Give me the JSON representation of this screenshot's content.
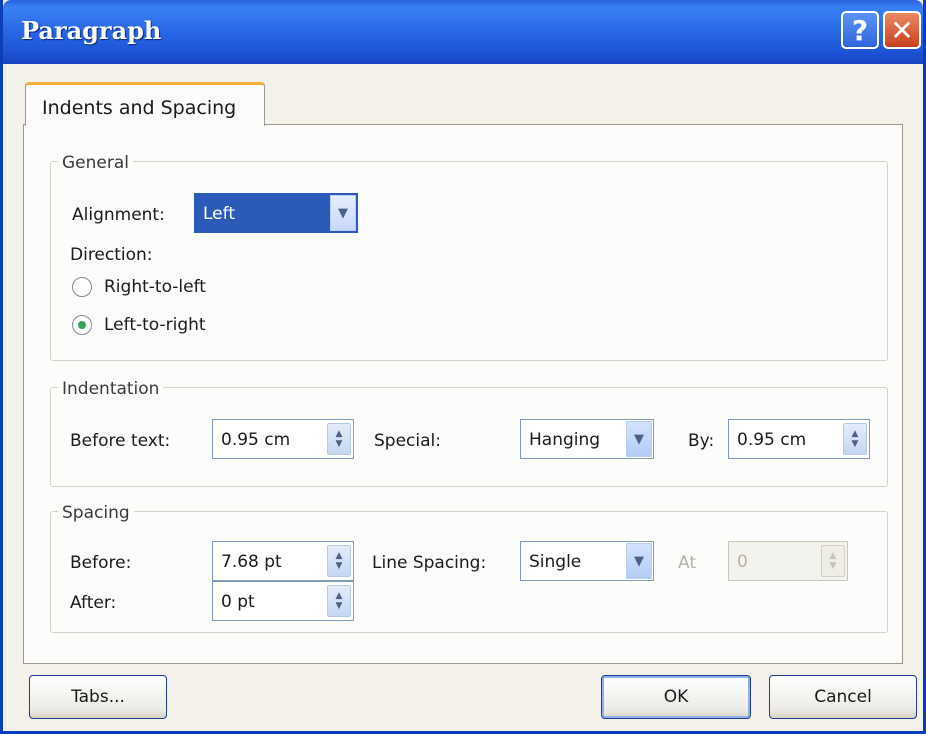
{
  "window": {
    "title": "Paragraph",
    "help_label": "?",
    "close_label": "✕"
  },
  "tabs": [
    {
      "label": "Indents and Spacing"
    }
  ],
  "general": {
    "legend": "General",
    "alignment_label": "Alignment:",
    "alignment_value": "Left",
    "direction_label": "Direction:",
    "rtl_label": "Right-to-left",
    "ltr_label": "Left-to-right",
    "selected_direction": "Left-to-right"
  },
  "indentation": {
    "legend": "Indentation",
    "before_text_label": "Before text:",
    "before_text_value": "0.95 cm",
    "special_label": "Special:",
    "special_value": "Hanging",
    "by_label": "By:",
    "by_value": "0.95 cm"
  },
  "spacing": {
    "legend": "Spacing",
    "before_label": "Before:",
    "before_value": "7.68 pt",
    "after_label": "After:",
    "after_value": "0 pt",
    "line_spacing_label": "Line Spacing:",
    "line_spacing_value": "Single",
    "at_label": "At",
    "at_value": "0"
  },
  "footer": {
    "tabs_button": "Tabs...",
    "ok_button": "OK",
    "cancel_button": "Cancel"
  },
  "colors": {
    "titlebar": "#2a63df",
    "selection": "#2c5ab8",
    "tab_accent": "#f6b33b"
  }
}
